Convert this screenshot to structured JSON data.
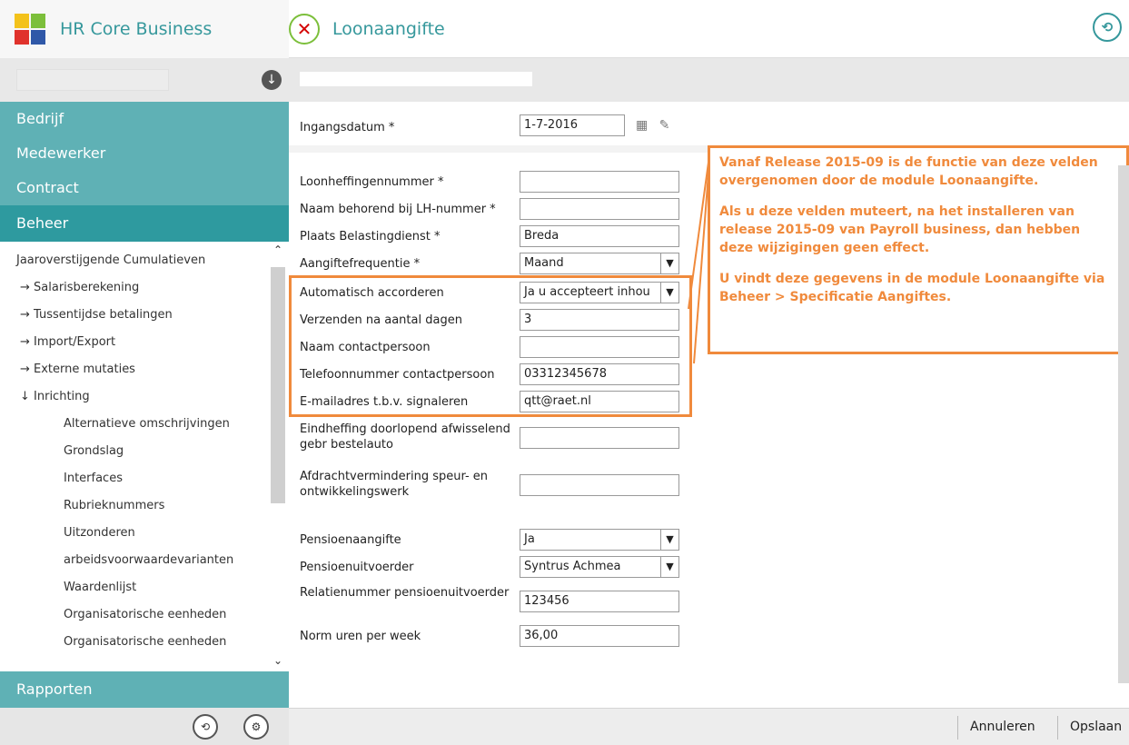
{
  "app": {
    "title": "HR Core Business",
    "module_title": "Loonaangifte"
  },
  "sidebar": {
    "sections": [
      "Bedrijf",
      "Medewerker",
      "Contract"
    ],
    "active_section": "Beheer",
    "items": [
      {
        "label": "Jaaroverstijgende Cumulatieven"
      },
      {
        "label": "→ Salarisberekening"
      },
      {
        "label": "→ Tussentijdse betalingen"
      },
      {
        "label": "→ Import/Export"
      },
      {
        "label": "→ Externe mutaties"
      },
      {
        "label": "↓ Inrichting"
      },
      {
        "label": "Alternatieve omschrijvingen"
      },
      {
        "label": "Grondslag"
      },
      {
        "label": "Interfaces"
      },
      {
        "label": "Rubrieknummers"
      },
      {
        "label": "Uitzonderen"
      },
      {
        "label": "arbeidsvoorwaardevarianten"
      },
      {
        "label": "Waardenlijst"
      },
      {
        "label": "Organisatorische eenheden"
      },
      {
        "label": "Organisatorische eenheden"
      }
    ],
    "bottom_section": "Rapporten"
  },
  "form": {
    "ingangsdatum_label": "Ingangsdatum *",
    "ingangsdatum_value": "1-7-2016",
    "fields": [
      {
        "label": "Loonheffingennummer *",
        "value": ""
      },
      {
        "label": "Naam behorend bij LH-nummer *",
        "value": ""
      },
      {
        "label": "Plaats Belastingdienst *",
        "value": "Breda"
      },
      {
        "label": "Aangiftefrequentie *",
        "value": "Maand"
      },
      {
        "label": "Automatisch accorderen",
        "value": "Ja u accepteert inhou"
      },
      {
        "label": "Verzenden na aantal dagen",
        "value": "3"
      },
      {
        "label": "Naam contactpersoon",
        "value": ""
      },
      {
        "label": "Telefoonnummer contactpersoon",
        "value": "03312345678"
      },
      {
        "label": "E-mailadres t.b.v. signaleren",
        "value": "qtt@raet.nl"
      },
      {
        "label": "Eindheffing doorlopend afwisselend gebr bestelauto",
        "value": ""
      },
      {
        "label": "Afdrachtvermindering speur- en ontwikkelingswerk",
        "value": ""
      },
      {
        "label": "Pensioenaangifte",
        "value": "Ja"
      },
      {
        "label": "Pensioenuitvoerder",
        "value": "Syntrus Achmea"
      },
      {
        "label": "Relatienummer pensioenuitvoerder",
        "value": "123456"
      },
      {
        "label": "Norm uren per week",
        "value": "36,00"
      }
    ]
  },
  "callout": {
    "p1": "Vanaf Release 2015-09 is de functie van deze velden overgenomen door de module Loonaangifte.",
    "p2": "Als u deze velden muteert, na het installeren van release 2015-09 van Payroll business, dan hebben deze wijzigingen geen effect.",
    "p3": "U vindt deze gegevens in de module Loonaangifte via Beheer > Specificatie Aangiftes."
  },
  "footer": {
    "cancel_label": "Annuleren",
    "save_label": "Opslaan"
  },
  "colors": {
    "accent": "#2e9a9f",
    "section": "#5fb1b5",
    "highlight": "#f08a3c"
  }
}
